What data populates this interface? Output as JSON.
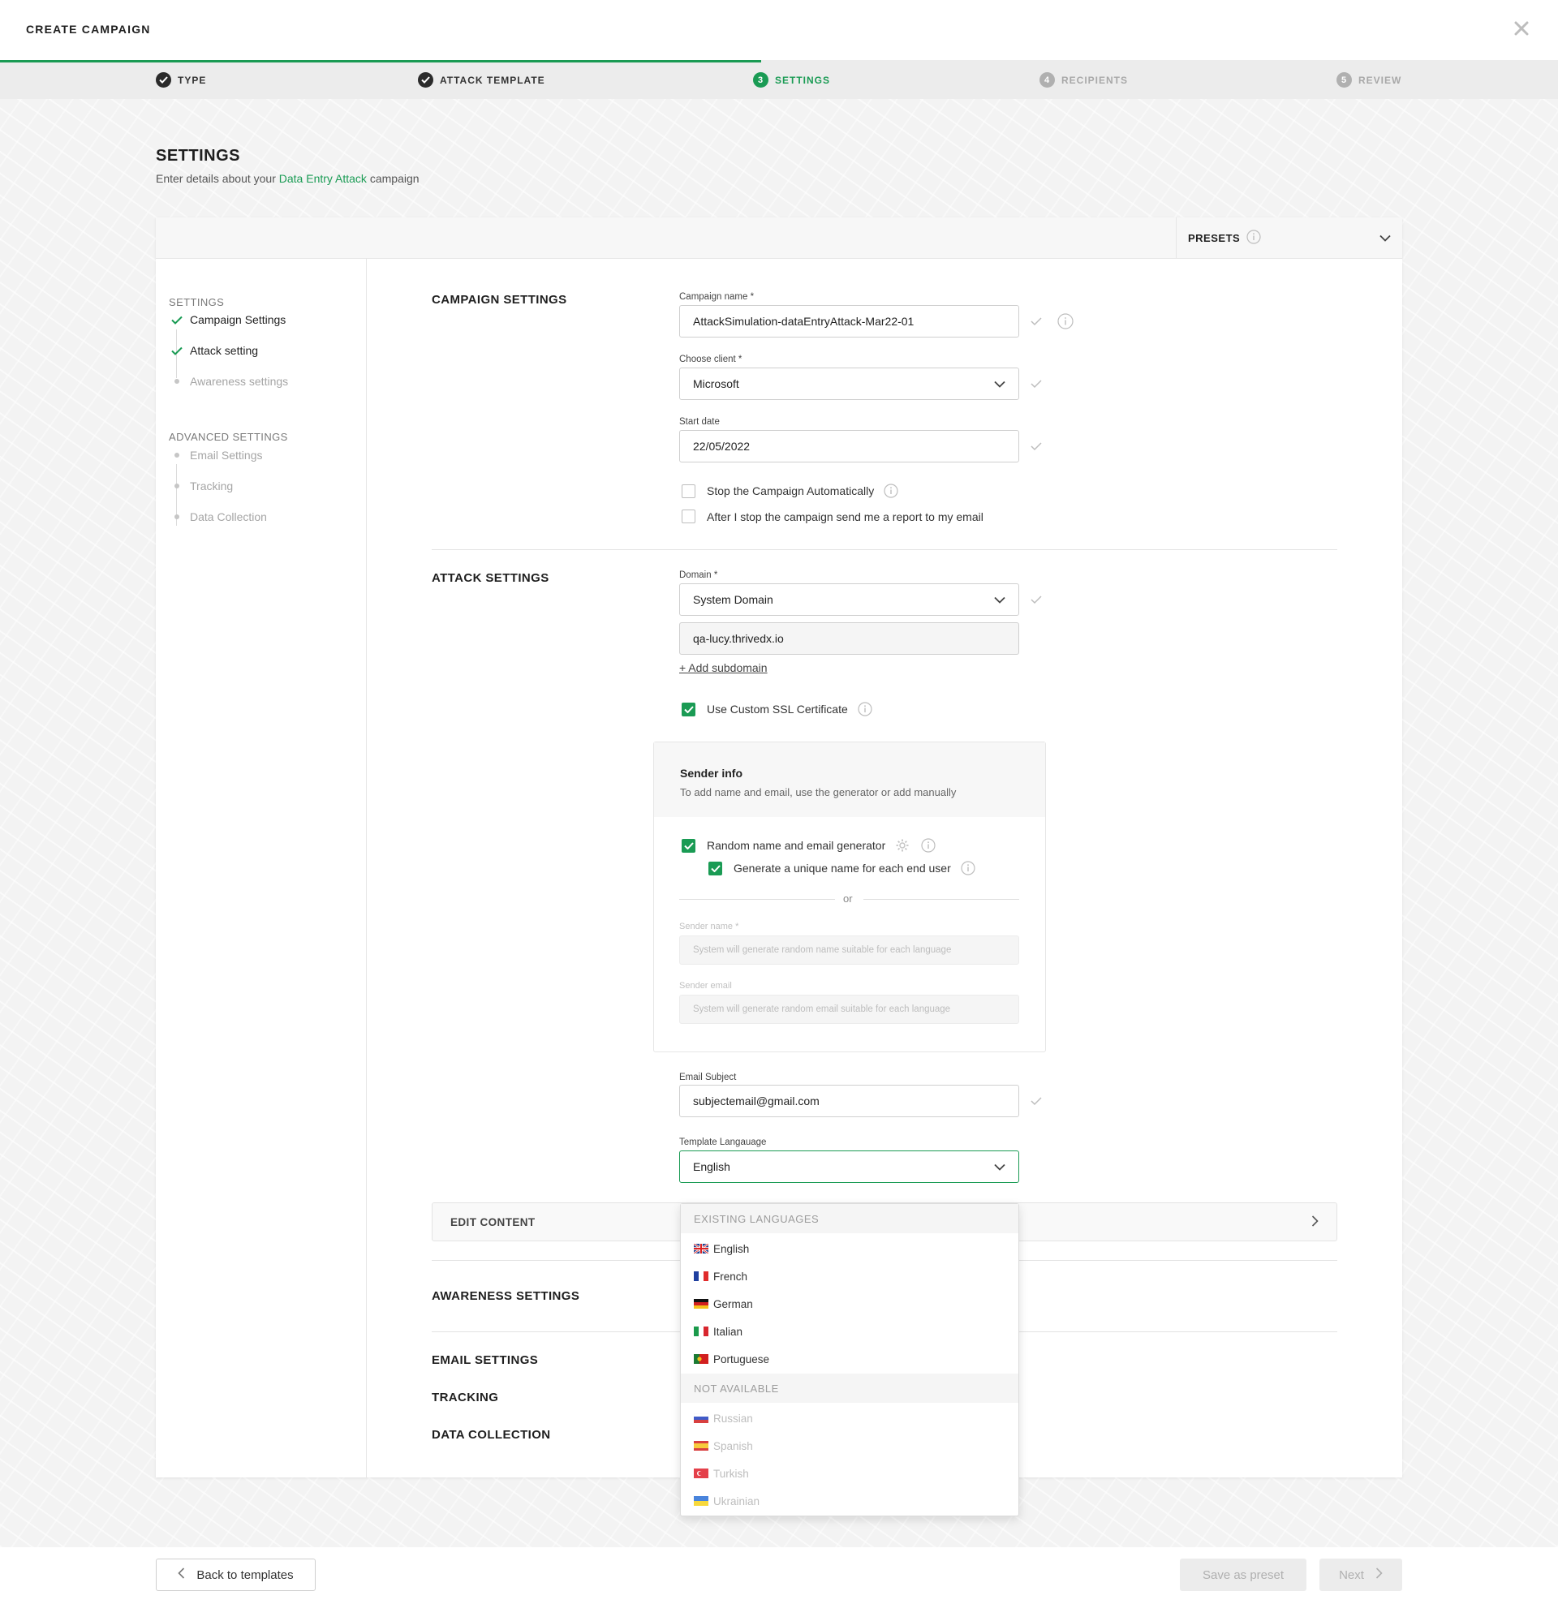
{
  "header": {
    "title": "CREATE CAMPAIGN",
    "close_icon": "close-icon"
  },
  "steps": [
    {
      "label": "TYPE",
      "state": "done"
    },
    {
      "label": "ATTACK TEMPLATE",
      "state": "done"
    },
    {
      "number": "3",
      "label": "SETTINGS",
      "state": "active"
    },
    {
      "number": "4",
      "label": "RECIPIENTS",
      "state": "todo"
    },
    {
      "number": "5",
      "label": "REVIEW",
      "state": "todo"
    }
  ],
  "page": {
    "title": "SETTINGS",
    "subtitle_pre": "Enter details about your",
    "subtitle_link": "Data Entry Attack",
    "subtitle_post": "campaign"
  },
  "presets": {
    "label": "PRESETS"
  },
  "sidebar": {
    "group1": "SETTINGS",
    "items1": [
      {
        "label": "Campaign Settings",
        "state": "done"
      },
      {
        "label": "Attack setting",
        "state": "done"
      },
      {
        "label": "Awareness settings",
        "state": "pending"
      }
    ],
    "group2": "ADVANCED SETTINGS",
    "items2": [
      {
        "label": "Email Settings",
        "state": "pending"
      },
      {
        "label": "Tracking",
        "state": "pending"
      },
      {
        "label": "Data Collection",
        "state": "pending"
      }
    ]
  },
  "campaign": {
    "section_title": "CAMPAIGN SETTINGS",
    "name_label": "Campaign name *",
    "name_value": "AttackSimulation-dataEntryAttack-Mar22-01",
    "client_label": "Choose client *",
    "client_value": "Microsoft",
    "start_label": "Start date",
    "start_value": "22/05/2022",
    "stop_auto_label": "Stop the Campaign Automatically",
    "report_label": "After I stop the campaign send me a report to my email"
  },
  "attack": {
    "section_title": "ATTACK SETTINGS",
    "domain_label": "Domain *",
    "domain_value": "System Domain",
    "subdomain_value": "qa-lucy.thrivedx.io",
    "add_subdomain": "+ Add subdomain",
    "ssl_label": "Use Custom SSL Certificate",
    "sender": {
      "title": "Sender info",
      "subtitle": "To add name and email, use the generator or add manually",
      "random_label": "Random name and email generator",
      "unique_label": "Generate a unique name for each end user",
      "or": "or",
      "name_label": "Sender name *",
      "name_placeholder": "System will generate random name suitable for each language",
      "email_label": "Sender email",
      "email_placeholder": "System will generate random email suitable for each language"
    },
    "subject_label": "Email Subject",
    "subject_value": "subjectemail@gmail.com",
    "language_label": "Template Langauage",
    "language_value": "English"
  },
  "edit_content": "EDIT CONTENT",
  "sections": {
    "awareness": "AWARENESS SETTINGS",
    "email": "EMAIL SETTINGS",
    "tracking": "TRACKING",
    "data_collection": "DATA COLLECTION"
  },
  "language_dropdown": {
    "existing_label": "EXISTING LANGUAGES",
    "existing": [
      "English",
      "French",
      "German",
      "Italian",
      "Portuguese"
    ],
    "na_label": "NOT AVAILABLE",
    "not_available": [
      "Russian",
      "Spanish",
      "Turkish",
      "Ukrainian"
    ]
  },
  "footer": {
    "back": "Back to templates",
    "save_preset": "Save as preset",
    "next": "Next"
  },
  "colors": {
    "accent": "#1a9b54",
    "muted": "#a8a8a8"
  }
}
